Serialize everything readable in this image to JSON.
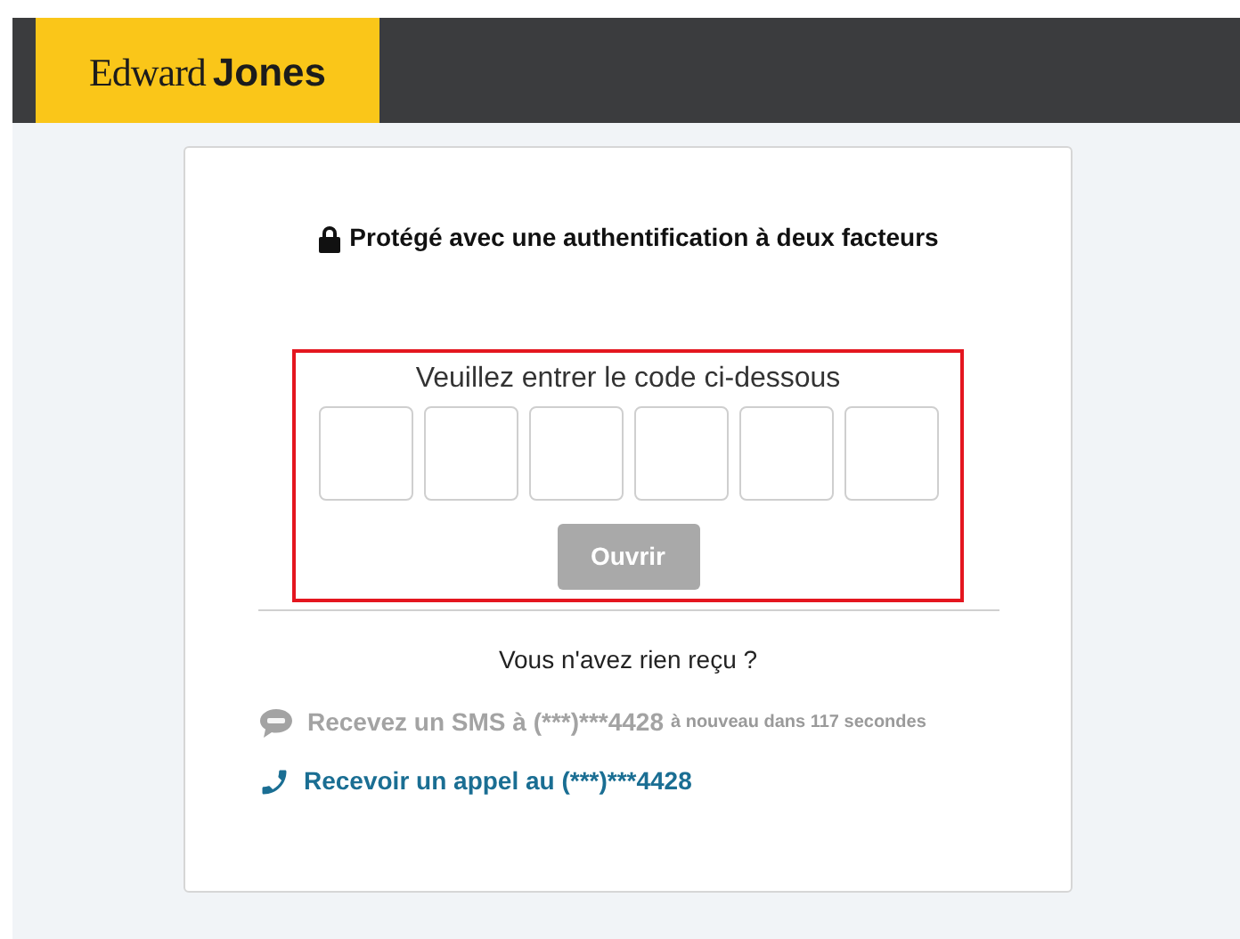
{
  "header": {
    "logo": {
      "name_first": "Edward",
      "name_last": "Jones"
    }
  },
  "card": {
    "title": "Protégé avec une authentification à deux facteurs",
    "code": {
      "prompt": "Veuillez entrer le code ci-dessous",
      "highlighted": true,
      "digits": [
        {
          "filled": false
        },
        {
          "filled": false
        },
        {
          "filled": false
        },
        {
          "filled": false
        },
        {
          "filled": false
        },
        {
          "filled": false
        }
      ],
      "button": {
        "label": "Ouvrir",
        "disabled": true
      }
    },
    "resend_prompt": "Vous n'avez rien reçu ?",
    "options": [
      {
        "kind": "sms",
        "label": "Recevez un SMS à (***)***4428",
        "note": "à nouveau dans 117 secondes",
        "disabled": true
      },
      {
        "kind": "call",
        "label": "Recevoir un appel au (***)***4428",
        "disabled": false
      }
    ]
  }
}
